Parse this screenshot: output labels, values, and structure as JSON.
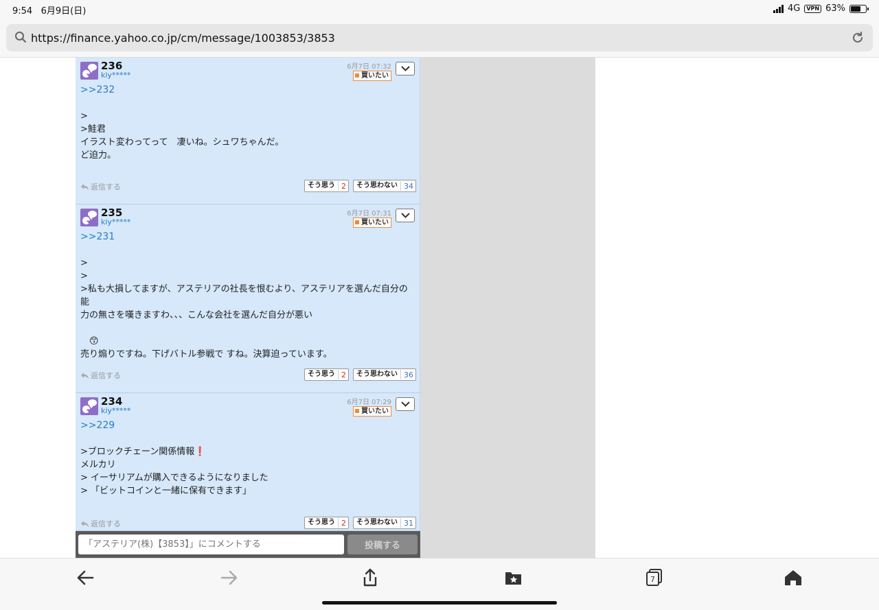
{
  "status": {
    "time": "9:54",
    "date": "6月9日(日)",
    "network": "4G",
    "vpn": "VPN",
    "battery": "63%",
    "battery_level": 0.63
  },
  "browser": {
    "url": "https://finance.yahoo.co.jp/cm/message/1003853/3853"
  },
  "posts": [
    {
      "number": "236",
      "user": "kiy*****",
      "date": "6月7日 07:32",
      "badge": "買いたい",
      "ref": ">>232",
      "lines": [
        "",
        ">",
        ">鮭君",
        "イラスト変わってって　凄いね。シュワちゃんだ。",
        "ど迫力。"
      ],
      "reply": "返信する",
      "agree_label": "そう思う",
      "agree": "2",
      "disagree_label": "そう思わない",
      "disagree": "34"
    },
    {
      "number": "235",
      "user": "kiy*****",
      "date": "6月7日 07:31",
      "badge": "買いたい",
      "ref": ">>231",
      "lines": [
        "",
        ">",
        ">",
        ">私も大損してますが、アステリアの社長を恨むより、アステリアを選んだ自分の能",
        "力の無さを嘆きますわ、、、こんな会社を選んだ自分が悪い",
        "",
        "　😙",
        "売り煽りですね。下げバトル参戦で すね。決算迫っています。"
      ],
      "reply": "返信する",
      "agree_label": "そう思う",
      "agree": "2",
      "disagree_label": "そう思わない",
      "disagree": "36"
    },
    {
      "number": "234",
      "user": "kiy*****",
      "date": "6月7日 07:29",
      "badge": "買いたい",
      "ref": ">>229",
      "lines": [
        "",
        ">ブロックチェーン関係情報❗",
        "メルカリ",
        "> イーサリアムが購入できるようになりました",
        "> 「ビットコインと一緒に保有できます」"
      ],
      "reply": "返信する",
      "agree_label": "そう思う",
      "agree": "2",
      "disagree_label": "そう思わない",
      "disagree": "31"
    }
  ],
  "composer": {
    "placeholder": "「アステリア(株)【3853】」にコメントする",
    "submit": "投稿する"
  },
  "toolbar": {
    "tabs_count": "7"
  }
}
